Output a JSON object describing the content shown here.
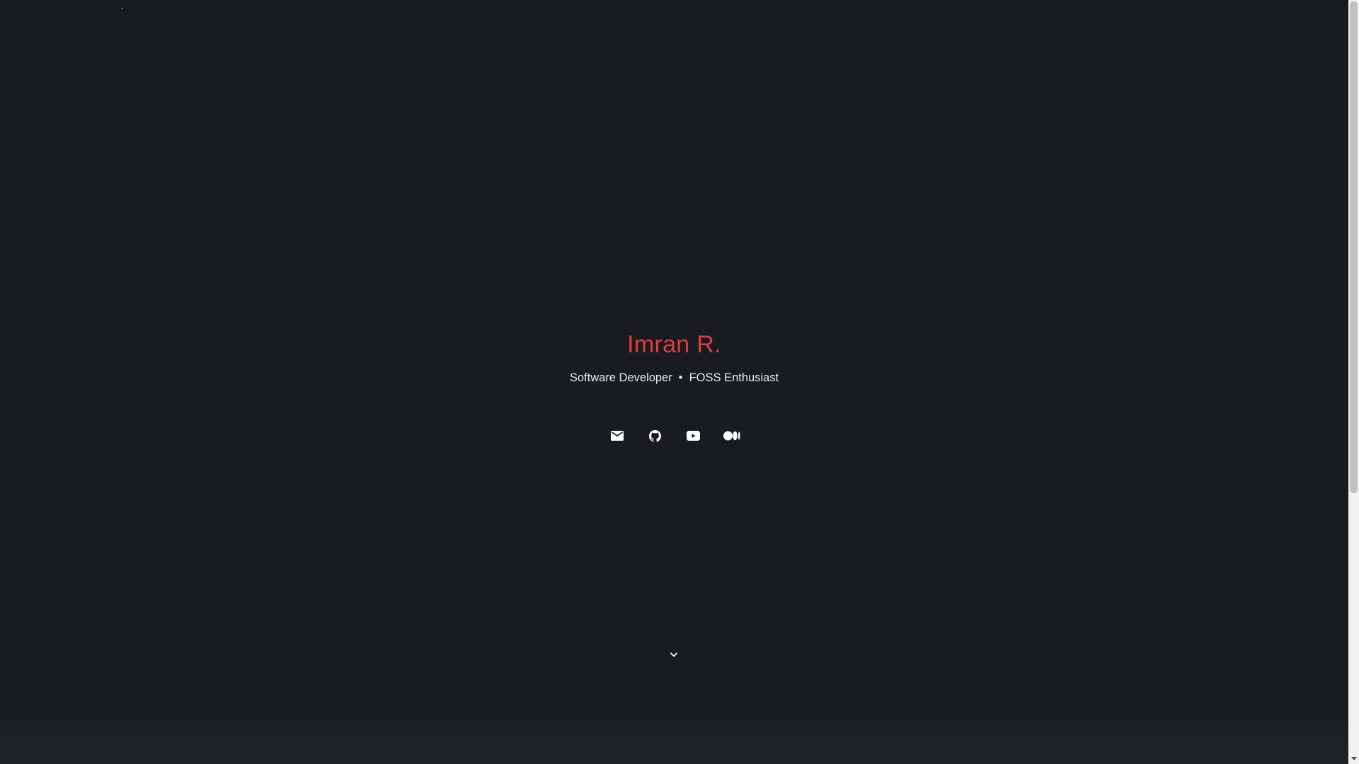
{
  "hero": {
    "name": "Imran R.",
    "tagline": {
      "role": "Software Developer",
      "separator": "•",
      "interest": "FOSS Enthusiast"
    }
  },
  "socials": [
    {
      "icon": "mail-icon"
    },
    {
      "icon": "github-icon"
    },
    {
      "icon": "youtube-icon"
    },
    {
      "icon": "medium-icon"
    }
  ],
  "scroll_indicator": {
    "icon": "chevron-down-icon"
  },
  "colors": {
    "background": "#181c20",
    "accent": "#e23b3b",
    "text": "#e7e9ea",
    "icon": "#ffffff"
  }
}
